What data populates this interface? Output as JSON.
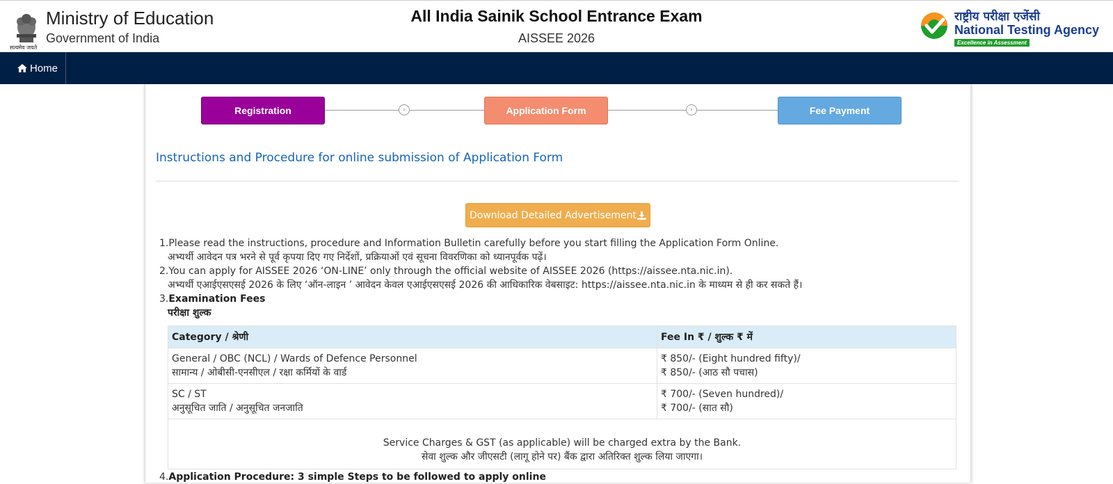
{
  "header": {
    "ministry_title": "Ministry of Education",
    "ministry_sub": "Government of India",
    "emblem_caption": "सत्यमेव जयते",
    "exam_title": "All India Sainik School Entrance Exam",
    "exam_sub": "AISSEE 2026",
    "nta_hindi": "राष्ट्रीय परीक्षा एजेंसी",
    "nta_english": "National Testing Agency",
    "nta_tagline": "Excellence in Assessment"
  },
  "nav": {
    "home_label": "Home"
  },
  "steps": {
    "registration": "Registration",
    "application_form": "Application Form",
    "fee_payment": "Fee Payment"
  },
  "section_title": "Instructions and Procedure for online submission of Application Form",
  "download_button": "Download Detailed Advertisement",
  "instructions": [
    {
      "num": "1.",
      "en": "Please read the instructions, procedure and Information Bulletin carefully before you start filling the Application Form Online.",
      "hi": "अभ्यर्थी आवेदन पत्र भरने से पूर्व कृपया दिए गए निर्देशों, प्रक्रियाओं एवं सूचना विवरणिका को ध्यानपूर्वक पढ़ें।"
    },
    {
      "num": "2.",
      "en": "You can apply for AISSEE 2026 ‘ON-LINE’ only through the official website of AISSEE 2026 (https://aissee.nta.nic.in).",
      "hi": "अभ्यर्थी एआईएसएसई 2026 के लिए ‘ऑन-लाइन ’ आवेदन केवल एआईएसएसई 2026 की आधिकारिक वेबसाइट: https://aissee.nta.nic.in के माध्यम से ही कर सकते हैं।"
    },
    {
      "num": "3.",
      "en": "Examination Fees",
      "hi": "परीक्षा शुल्क"
    },
    {
      "num": "4.",
      "en": "Application Procedure: 3 simple Steps to be followed to apply online"
    }
  ],
  "fee_table": {
    "headers": [
      "Category / श्रेणी",
      "Fee In ₹ / शुल्क ₹ में"
    ],
    "rows": [
      {
        "category_en": "General / OBC (NCL) / Wards of Defence Personnel",
        "category_hi": "सामान्य / ओबीसी-एनसीएल / रक्षा कर्मियों के वार्ड",
        "fee_en": "₹ 850/- (Eight hundred fifty)/",
        "fee_hi": "₹ 850/- (आठ सौ पचास)"
      },
      {
        "category_en": "SC / ST",
        "category_hi": "अनुसूचित जाति / अनुसूचित जनजाति",
        "fee_en": "₹ 700/- (Seven hundred)/",
        "fee_hi": "₹ 700/- (सात सौ)"
      }
    ],
    "note_en": "Service Charges & GST (as applicable) will be charged extra by the Bank.",
    "note_hi": "सेवा शुल्क और जीएसटी (लागू होने पर) बैंक द्वारा अतिरिक्त शुल्क लिया जाएगा।"
  },
  "colors": {
    "navbar": "#001f44",
    "registration_step": "#9a009a",
    "application_step": "#f48c70",
    "fee_step": "#64a9e0",
    "download_button": "#f0ad4e",
    "section_title": "#1565b8",
    "table_header": "#d9ecf7"
  }
}
